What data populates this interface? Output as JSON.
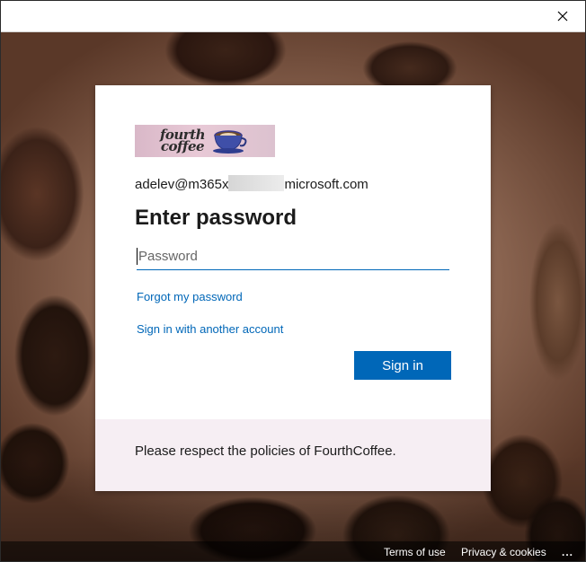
{
  "window": {
    "close_icon": "close-icon"
  },
  "card": {
    "logo": {
      "line1": "fourth",
      "line2": "coffee",
      "icon": "coffee-cup-icon"
    },
    "username_prefix": "adelev@m365x",
    "username_suffix": "microsoft.com",
    "title": "Enter password",
    "password": {
      "value": "",
      "placeholder": "Password"
    },
    "forgot_link": "Forgot my password",
    "another_account_link": "Sign in with another account",
    "signin_button": "Sign in",
    "policy_text": "Please respect the policies of FourthCoffee."
  },
  "footer": {
    "terms": "Terms of use",
    "privacy": "Privacy & cookies",
    "more": "..."
  },
  "colors": {
    "accent": "#0067b8",
    "footer_band": "#f6eef3"
  }
}
